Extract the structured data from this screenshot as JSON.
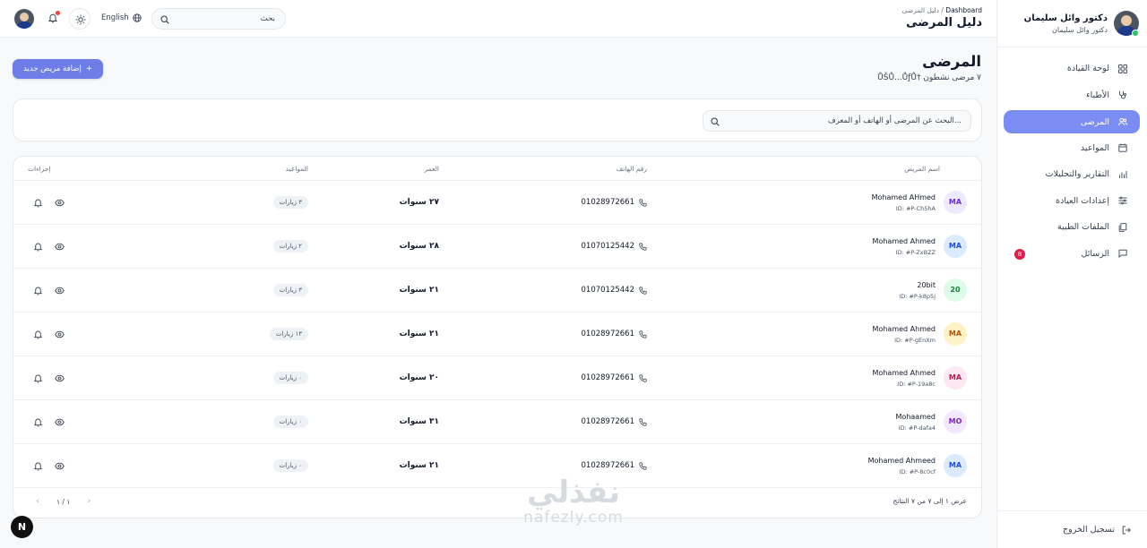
{
  "profile": {
    "name": "دكتور وائل سليمان",
    "subtitle": "دكتور وائل سليمان"
  },
  "sidebar": {
    "items": [
      {
        "label": "لوحة القيادة",
        "icon": "grid-icon",
        "active": false
      },
      {
        "label": "الأطباء",
        "icon": "stethoscope-icon",
        "active": false
      },
      {
        "label": "المرضى",
        "icon": "users-icon",
        "active": true
      },
      {
        "label": "المواعيد",
        "icon": "calendar-icon",
        "active": false
      },
      {
        "label": "التقارير والتحليلات",
        "icon": "bar-chart-icon",
        "active": false
      },
      {
        "label": "إعدادات العيادة",
        "icon": "sliders-icon",
        "active": false
      },
      {
        "label": "الملفات الطبية",
        "icon": "files-icon",
        "active": false
      },
      {
        "label": "الرسائل",
        "icon": "message-icon",
        "active": false,
        "badge": "8"
      }
    ],
    "logout_label": "تسجيل الخروج"
  },
  "header": {
    "breadcrumb_root": "Dashboard",
    "breadcrumb_sep": "/",
    "breadcrumb_current": "دليل المرضى",
    "title": "دليل المرضى",
    "search_placeholder": "بحث",
    "language_label": "English"
  },
  "main": {
    "title": "المرضى",
    "subtitle": "ŮŠŮ...ŮƒŮ† ٧ مرضى نشطون",
    "add_button_label": "إضافة مريض جديد",
    "search_placeholder": "البحث عن المرضى أو الهاتف أو المعرف...",
    "columns": {
      "name": "اسم المريض",
      "phone": "رقم الهاتف",
      "age": "العمر",
      "visits": "المواعيد",
      "actions": "إجراءات"
    },
    "rows": [
      {
        "initials": "MA",
        "name": "Mohamed AHmed",
        "id": "ID: #P-Ch5hA",
        "phone": "01028972661",
        "age": "٢٧ سنوات",
        "visits": "٣ زيارات",
        "avatar_bg": "#ede9fe",
        "avatar_fg": "#6d28d9"
      },
      {
        "initials": "MA",
        "name": "Mohamed Ahmed",
        "id": "ID: #P-ZxBZZ",
        "phone": "01070125442",
        "age": "٢٨ سنوات",
        "visits": "٢ زيارات",
        "avatar_bg": "#dbeafe",
        "avatar_fg": "#1d4ed8"
      },
      {
        "initials": "20",
        "name": "20bit",
        "id": "ID: #P-k8p5j",
        "phone": "01070125442",
        "age": "٢١ سنوات",
        "visits": "٣ زيارات",
        "avatar_bg": "#dcfce7",
        "avatar_fg": "#15803d"
      },
      {
        "initials": "MA",
        "name": "Mohamed Ahmed",
        "id": "ID: #P-gEnXm",
        "phone": "01028972661",
        "age": "٢١ سنوات",
        "visits": "١٣ زيارات",
        "avatar_bg": "#fef3c7",
        "avatar_fg": "#b45309"
      },
      {
        "initials": "MA",
        "name": "Mohamed Ahmed",
        "id": "ID: #P-19a8c",
        "phone": "01028972661",
        "age": "٢٠ سنوات",
        "visits": "٠ زيارات",
        "avatar_bg": "#fce7f3",
        "avatar_fg": "#be185d"
      },
      {
        "initials": "MO",
        "name": "Mohaamed",
        "id": "ID: #P-dafa4",
        "phone": "01028972661",
        "age": "٣١ سنوات",
        "visits": "٠ زيارات",
        "avatar_bg": "#f3e8ff",
        "avatar_fg": "#7e22ce"
      },
      {
        "initials": "MA",
        "name": "Mohamed Ahmeed",
        "id": "ID: #P-8c0cf",
        "phone": "01028972661",
        "age": "٢١ سنوات",
        "visits": "٠ زيارات",
        "avatar_bg": "#dbeafe",
        "avatar_fg": "#1d4ed8"
      }
    ],
    "footer_results": "عرض ١ إلى ٧ من ٧ النتائج",
    "pagination": "١ / ١"
  },
  "watermark": {
    "arabic": "نفذلي",
    "latin": "nafezly.com"
  },
  "corner_badge": "N",
  "colors": {
    "accent": "#7b8cf3",
    "button": "#6f7de8",
    "badge": "#e11d48",
    "online": "#22c55e"
  }
}
